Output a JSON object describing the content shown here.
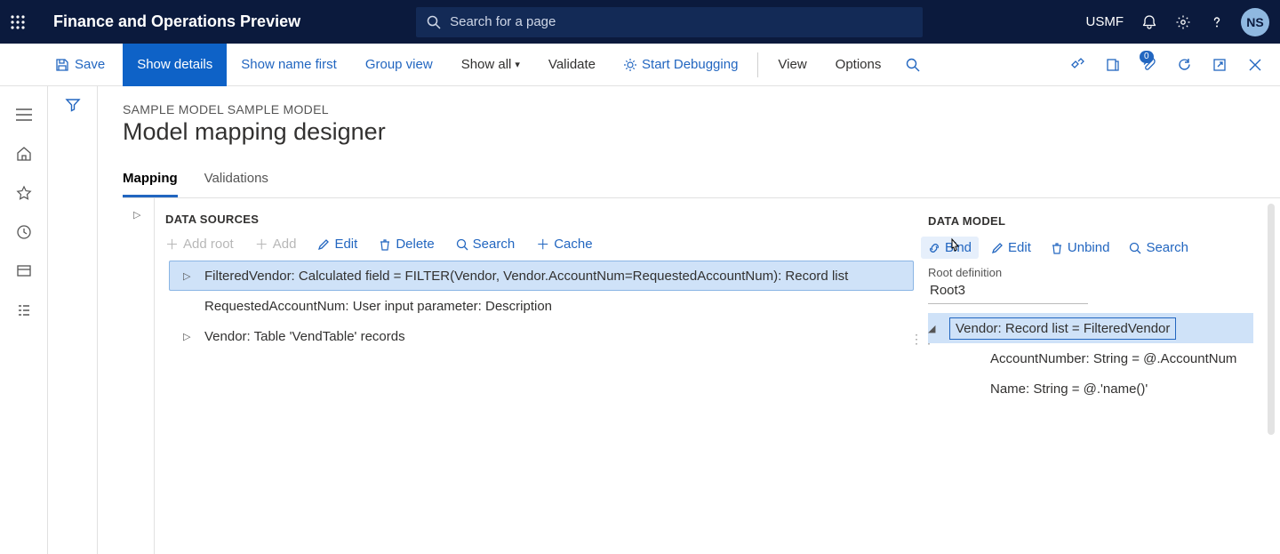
{
  "banner": {
    "title": "Finance and Operations Preview",
    "search_placeholder": "Search for a page",
    "company": "USMF",
    "avatar": "NS"
  },
  "cmdbar": {
    "save": "Save",
    "show_details": "Show details",
    "show_name_first": "Show name first",
    "group_view": "Group view",
    "show_all": "Show all",
    "validate": "Validate",
    "start_debugging": "Start Debugging",
    "view": "View",
    "options": "Options",
    "badge": "0"
  },
  "page": {
    "breadcrumb": "SAMPLE MODEL SAMPLE MODEL",
    "title": "Model mapping designer",
    "tabs": {
      "mapping": "Mapping",
      "validations": "Validations"
    }
  },
  "ds": {
    "heading": "DATA SOURCES",
    "toolbar": {
      "add_root": "Add root",
      "add": "Add",
      "edit": "Edit",
      "delete": "Delete",
      "search": "Search",
      "cache": "Cache"
    },
    "nodes": {
      "filtered_vendor": "FilteredVendor: Calculated field = FILTER(Vendor, Vendor.AccountNum=RequestedAccountNum): Record list",
      "requested": "RequestedAccountNum: User input parameter: Description",
      "vendor": "Vendor: Table 'VendTable' records"
    }
  },
  "dm": {
    "heading": "DATA MODEL",
    "toolbar": {
      "bind": "Bind",
      "edit": "Edit",
      "unbind": "Unbind",
      "search": "Search"
    },
    "root_label": "Root definition",
    "root_value": "Root3",
    "nodes": {
      "vendor": "Vendor: Record list = FilteredVendor",
      "account": "AccountNumber: String = @.AccountNum",
      "name": "Name: String = @.'name()'"
    }
  }
}
